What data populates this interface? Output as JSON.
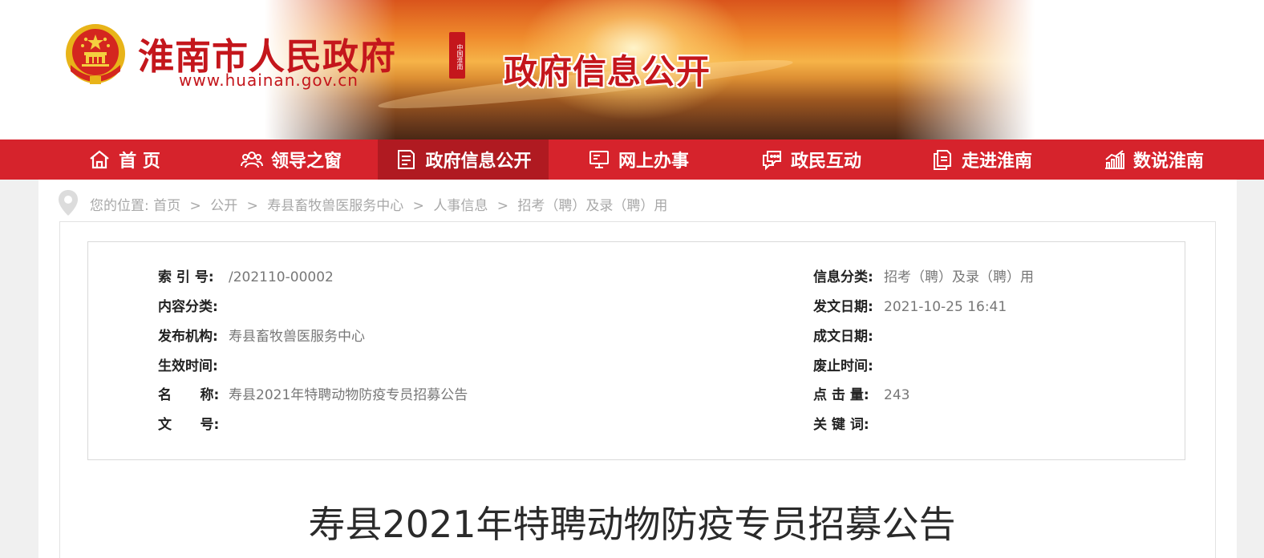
{
  "colors": {
    "primary_red": "#d6232c",
    "active_nav": "#b01a21",
    "brand_red": "#c4161c"
  },
  "header": {
    "site_name": "淮南市人民政府",
    "site_url": "www.huainan.gov.cn",
    "seal_text": "中国淮南",
    "section_title": "政府信息公开",
    "emblem_icon": "national-emblem-icon"
  },
  "nav": {
    "items": [
      {
        "label": "首 页",
        "icon": "home-icon"
      },
      {
        "label": "领导之窗",
        "icon": "users-icon"
      },
      {
        "label": "政府信息公开",
        "icon": "document-icon",
        "active": true
      },
      {
        "label": "网上办事",
        "icon": "monitor-icon"
      },
      {
        "label": "政民互动",
        "icon": "chat-icon"
      },
      {
        "label": "走进淮南",
        "icon": "pages-icon"
      },
      {
        "label": "数说淮南",
        "icon": "bar-chart-icon"
      }
    ]
  },
  "breadcrumb": {
    "prefix": "您的位置:",
    "items": [
      "首页",
      "公开",
      "寿县畜牧兽医服务中心",
      "人事信息",
      "招考（聘）及录（聘）用"
    ],
    "separator": ">"
  },
  "meta": {
    "index_label": "索 引 号:",
    "index_value": "/202110-00002",
    "category_label": "信息分类:",
    "category_value": "招考（聘）及录（聘）用",
    "content_type_label": "内容分类:",
    "content_type_value": "",
    "publish_date_label": "发文日期:",
    "publish_date_value": "2021-10-25 16:41",
    "publisher_label": "发布机构:",
    "publisher_value": "寿县畜牧兽医服务中心",
    "written_date_label": "成文日期:",
    "written_date_value": "",
    "effective_label": "生效时间:",
    "effective_value": "",
    "expire_label": "废止时间:",
    "expire_value": "",
    "name_label": "名      称:",
    "name_value": "寿县2021年特聘动物防疫专员招募公告",
    "views_label": "点 击 量:",
    "views_value": "243",
    "doc_no_label": "文      号:",
    "doc_no_value": "",
    "keywords_label": "关 键 词:",
    "keywords_value": ""
  },
  "article": {
    "title": "寿县2021年特聘动物防疫专员招募公告"
  }
}
